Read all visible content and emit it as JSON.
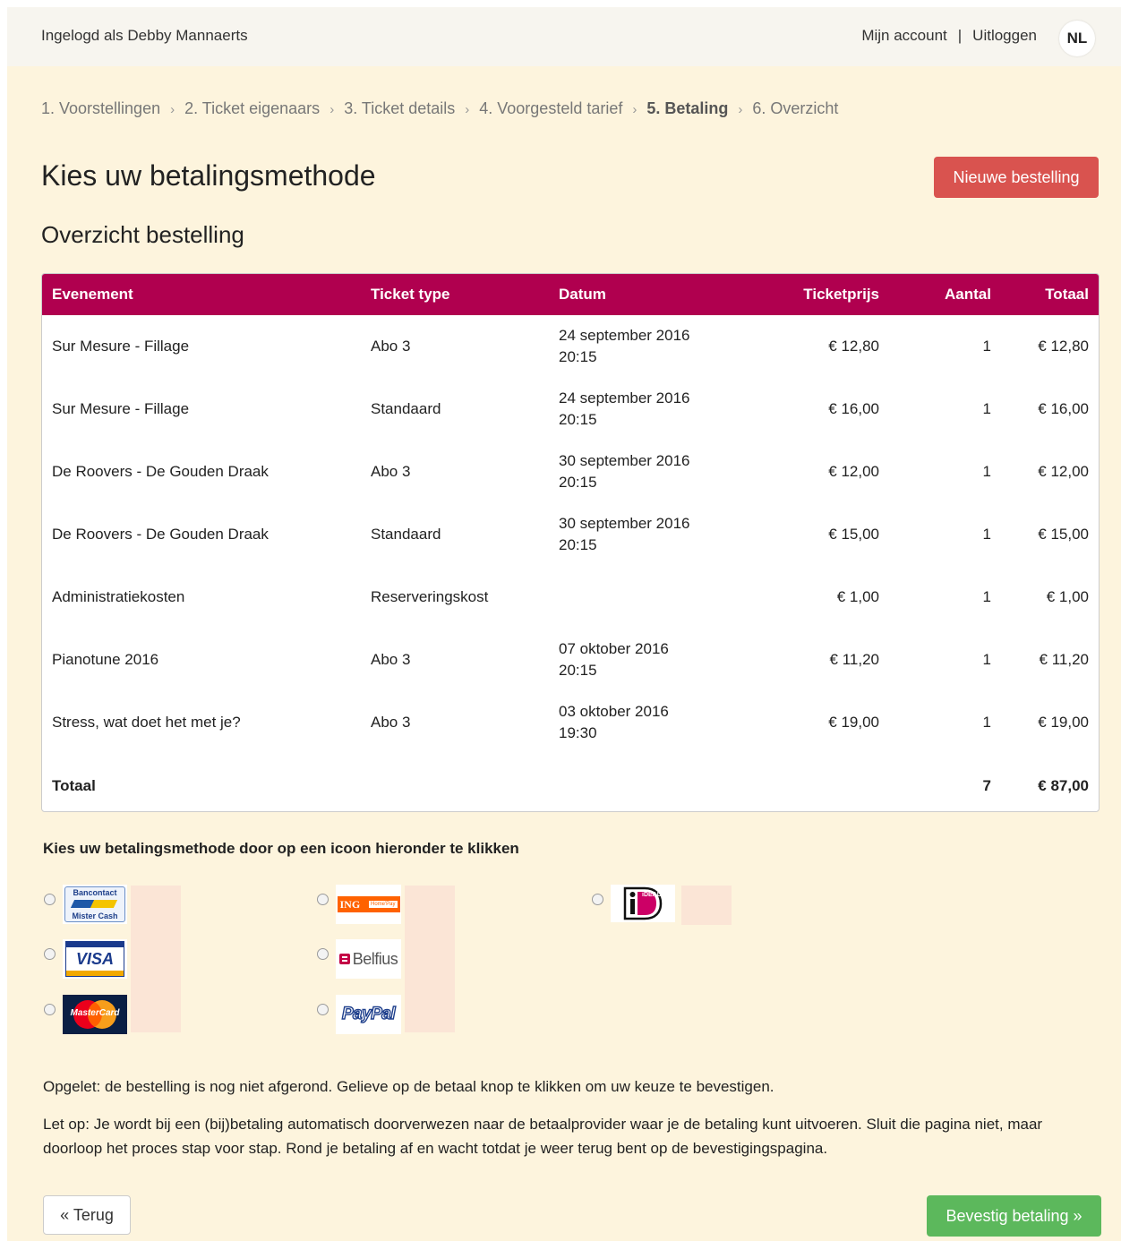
{
  "header": {
    "logged_in_text": "Ingelogd als Debby Mannaerts",
    "account_link": "Mijn account",
    "separator": "|",
    "logout_link": "Uitloggen",
    "language": "NL"
  },
  "steps": [
    {
      "label": "1. Voorstellingen"
    },
    {
      "label": "2. Ticket eigenaars"
    },
    {
      "label": "3. Ticket details"
    },
    {
      "label": "4. Voorgesteld tarief"
    },
    {
      "label": "5. Betaling",
      "active": true
    },
    {
      "label": "6. Overzicht"
    }
  ],
  "step_separator": "›",
  "page_title": "Kies uw betalingsmethode",
  "new_order_button": "Nieuwe bestelling",
  "overview_title": "Overzicht bestelling",
  "table": {
    "headers": [
      "Evenement",
      "Ticket type",
      "Datum",
      "Ticketprijs",
      "Aantal",
      "Totaal"
    ],
    "rows": [
      {
        "event": "Sur Mesure - Fillage",
        "type": "Abo 3",
        "date": "24 september 2016",
        "time": "20:15",
        "price": "€ 12,80",
        "qty": "1",
        "total": "€ 12,80"
      },
      {
        "event": "Sur Mesure - Fillage",
        "type": "Standaard",
        "date": "24 september 2016",
        "time": "20:15",
        "price": "€ 16,00",
        "qty": "1",
        "total": "€ 16,00"
      },
      {
        "event": "De Roovers - De Gouden Draak",
        "type": "Abo 3",
        "date": "30 september 2016",
        "time": "20:15",
        "price": "€ 12,00",
        "qty": "1",
        "total": "€ 12,00"
      },
      {
        "event": "De Roovers - De Gouden Draak",
        "type": "Standaard",
        "date": "30 september 2016",
        "time": "20:15",
        "price": "€ 15,00",
        "qty": "1",
        "total": "€ 15,00"
      },
      {
        "event": "Administratiekosten",
        "type": "Reserveringskost",
        "date": "",
        "time": "",
        "price": "€ 1,00",
        "qty": "1",
        "total": "€ 1,00"
      },
      {
        "event": "Pianotune 2016",
        "type": "Abo 3",
        "date": "07 oktober 2016",
        "time": "20:15",
        "price": "€ 11,20",
        "qty": "1",
        "total": "€ 11,20"
      },
      {
        "event": "Stress, wat doet het met je?",
        "type": "Abo 3",
        "date": "03 oktober 2016",
        "time": "19:30",
        "price": "€ 19,00",
        "qty": "1",
        "total": "€ 19,00"
      }
    ],
    "total_row": {
      "label": "Totaal",
      "qty": "7",
      "total": "€ 87,00"
    }
  },
  "payment": {
    "instruction": "Kies uw betalingsmethode door op een icoon hieronder te klikken",
    "methods": [
      {
        "name": "bancontact",
        "line1": "Bancontact",
        "line2": "Mister Cash"
      },
      {
        "name": "ing",
        "text": "ING",
        "subtext": "Home'Pay"
      },
      {
        "name": "ideal",
        "text": "iDEAL"
      },
      {
        "name": "visa",
        "text": "VISA"
      },
      {
        "name": "belfius",
        "text": "Belfius"
      },
      {
        "name": "mastercard",
        "text": "MasterCard"
      },
      {
        "name": "paypal",
        "text": "PayPal"
      }
    ]
  },
  "notes": {
    "warning": "Opgelet: de bestelling is nog niet afgerond. Gelieve op de betaal knop te klikken om uw keuze te bevestigen.",
    "info": "Let op: Je wordt bij een (bij)betaling automatisch doorverwezen naar de betaalprovider waar je de betaling kunt uitvoeren. Sluit die pagina niet, maar doorloop het proces stap voor stap. Rond je betaling af en wacht totdat je weer terug bent op de bevestigingspagina."
  },
  "buttons": {
    "back": "« Terug",
    "confirm": "Bevestig betaling »"
  },
  "colors": {
    "table_header": "#b0004f",
    "danger": "#d9534f",
    "success": "#5cb85c",
    "page_bg": "#fdf4dd"
  }
}
